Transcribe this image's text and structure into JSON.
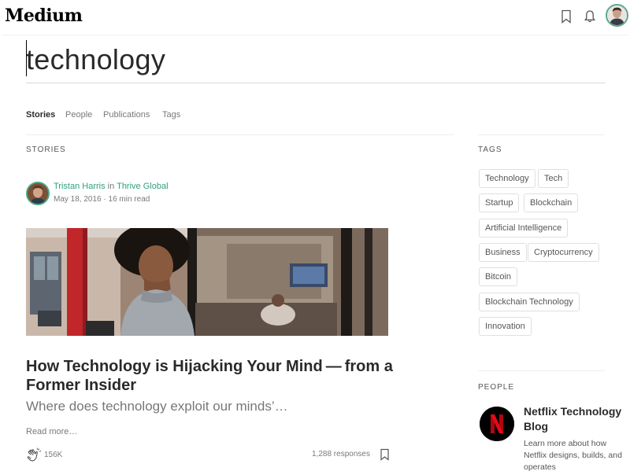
{
  "header": {
    "logo": "Medium",
    "icons": [
      "bookmark-icon",
      "bell-icon",
      "avatar"
    ]
  },
  "search": {
    "value": "technology"
  },
  "tabs": [
    {
      "label": "Stories",
      "active": true
    },
    {
      "label": "People",
      "active": false
    },
    {
      "label": "Publications",
      "active": false
    },
    {
      "label": "Tags",
      "active": false
    }
  ],
  "stories": {
    "section_label": "Stories",
    "story": {
      "author": "Tristan Harris",
      "in": "in",
      "publication": "Thrive Global",
      "date": "May 18, 2016",
      "separator": "·",
      "read_time": "16 min read",
      "title": "How Technology is Hijacking Your Mind — from a Former Insider",
      "subtitle": "Where does technology exploit our minds’…",
      "read_more": "Read more…",
      "claps": "156K",
      "responses": "1,288 responses"
    }
  },
  "tags": {
    "section_label": "Tags",
    "items": [
      "Technology",
      "Tech",
      "Startup",
      "Blockchain",
      "Artificial Intelligence",
      "Business",
      "Cryptocurrency",
      "Bitcoin",
      "Blockchain Technology",
      "Innovation"
    ]
  },
  "people": {
    "section_label": "People",
    "publication": {
      "name": "Netflix Technology Blog",
      "description": "Learn more about how Netflix designs, builds, and operates"
    }
  },
  "colors": {
    "accent_green": "#30a080",
    "netflix_red": "#e50914"
  }
}
